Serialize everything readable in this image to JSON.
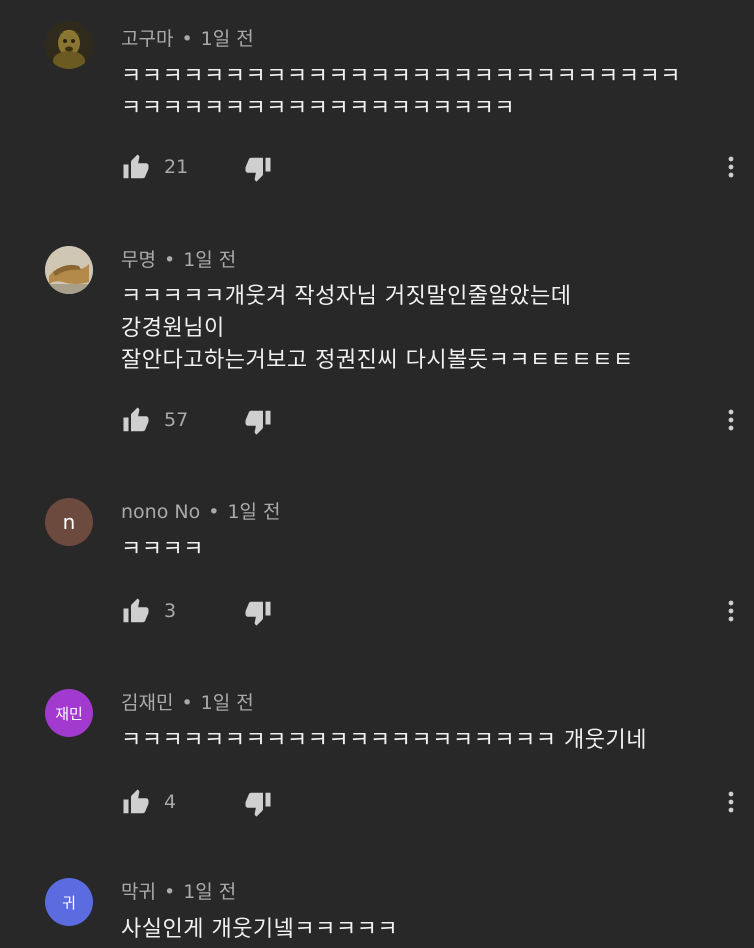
{
  "separator": "•",
  "comments": [
    {
      "author": "고구마",
      "time": "1일 전",
      "lines": [
        "ㅋㅋㅋㅋㅋㅋㅋㅋㅋㅋㅋㅋㅋㅋㅋㅋㅋㅋㅋㅋㅋㅋㅋㅋㅋㅋㅋ",
        "ㅋㅋㅋㅋㅋㅋㅋㅋㅋㅋㅋㅋㅋㅋㅋㅋㅋㅋㅋ"
      ],
      "likes": "21",
      "avatar": {
        "type": "image-icon",
        "color": "#7a6a2a"
      }
    },
    {
      "author": "무명",
      "time": "1일 전",
      "lines": [
        "ㅋㅋㅋㅋㅋ개웃겨 작성자님 거짓말인줄알았는데",
        "강경원님이",
        "잘안다고하는거보고 정권진씨 다시볼듯ㅋㅋㅌㅌㅌㅌㅌ"
      ],
      "likes": "57",
      "avatar": {
        "type": "image-icon",
        "color": "#9a8f7a"
      }
    },
    {
      "author": "nono No",
      "time": "1일 전",
      "lines": [
        "ㅋㅋㅋㅋ"
      ],
      "likes": "3",
      "avatar": {
        "type": "letter",
        "text": "n",
        "color": "#6d4a3e"
      }
    },
    {
      "author": "김재민",
      "time": "1일 전",
      "lines": [
        "ㅋㅋㅋㅋㅋㅋㅋㅋㅋㅋㅋㅋㅋㅋㅋㅋㅋㅋㅋㅋㅋ 개웃기네"
      ],
      "likes": "4",
      "avatar": {
        "type": "letter",
        "text": "재민",
        "color": "#a23ad0"
      }
    },
    {
      "author": "막귀",
      "time": "1일 전",
      "lines": [
        "사실인게 개웃기넼ㅋㅋㅋㅋㅋ"
      ],
      "likes": "",
      "avatar": {
        "type": "letter",
        "text": "귀",
        "color": "#5b6be0"
      }
    }
  ],
  "icons": {
    "like": "thumbs-up-icon",
    "dislike": "thumbs-down-icon",
    "more": "more-vertical-icon"
  }
}
